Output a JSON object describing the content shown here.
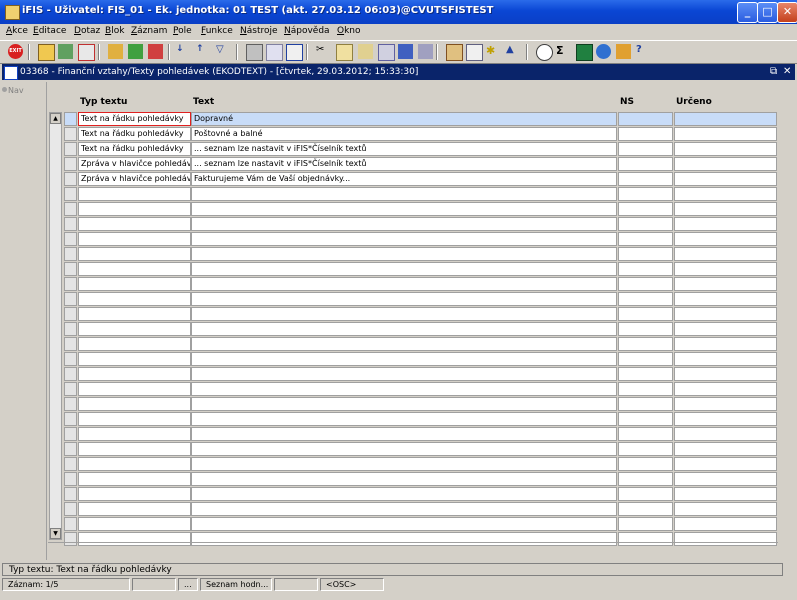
{
  "window": {
    "title": "iFIS - Uživatel: FIS_01 - Ek. jednotka: 01 TEST (akt. 27.03.12 06:03)@CVUTSFISTEST",
    "minimize": "_",
    "maximize": "□",
    "close": "✕"
  },
  "menu": [
    "Akce",
    "Editace",
    "Dotaz",
    "Blok",
    "Záznam",
    "Pole",
    "Funkce",
    "Nástroje",
    "Nápověda",
    "Okno"
  ],
  "toolbar": {
    "exit_label": "EXIT",
    "icons": [
      "save-icon",
      "print-icon",
      "delete-icon",
      "search-icon",
      "query-icon",
      "filter-icon",
      "sort-asc-icon",
      "sort-desc-icon",
      "funnel-icon",
      "printer-icon",
      "export-icon",
      "window-icon",
      "cut-icon",
      "copy-icon",
      "paste-icon",
      "find-icon",
      "list-icon",
      "tree-icon",
      "calendar-icon",
      "doc-icon",
      "star-icon",
      "mountain-icon",
      "clock-icon",
      "sum-icon",
      "excel-icon",
      "globe-icon",
      "user-icon",
      "help-icon"
    ]
  },
  "form": {
    "title": "03368 - Finanční vztahy/Texty pohledávek (EKODTEXT) - [čtvrtek, 29.03.2012; 15:33:30]",
    "restore": "⧉",
    "close": "✕",
    "nav_label": "Nav"
  },
  "columns": {
    "typ": "Typ textu",
    "text": "Text",
    "ns": "NS",
    "urceno": "Určeno"
  },
  "rows": [
    {
      "typ": "Text na řádku pohledávky",
      "text": "Dopravné",
      "ns": "",
      "urceno": ""
    },
    {
      "typ": "Text na řádku pohledávky",
      "text": "Poštovné a balné",
      "ns": "",
      "urceno": ""
    },
    {
      "typ": "Text na řádku pohledávky",
      "text": "... seznam lze nastavit v iFIS*Číselník textů",
      "ns": "",
      "urceno": ""
    },
    {
      "typ": "Zpráva v hlavičce pohledávky",
      "text": "... seznam lze nastavit v iFIS*Číselník textů",
      "ns": "",
      "urceno": ""
    },
    {
      "typ": "Zpráva v hlavičce pohledávky",
      "text": "Fakturujeme Vám de Vaší objednávky...",
      "ns": "",
      "urceno": ""
    }
  ],
  "lov_button": "...",
  "hint": "Typ textu: Text na řádku pohledávky",
  "status": {
    "record": "Záznam: 1/5",
    "s2": "",
    "s3": "...",
    "s4": "Seznam hodn...",
    "s5": "",
    "s6": "<OSC>"
  }
}
